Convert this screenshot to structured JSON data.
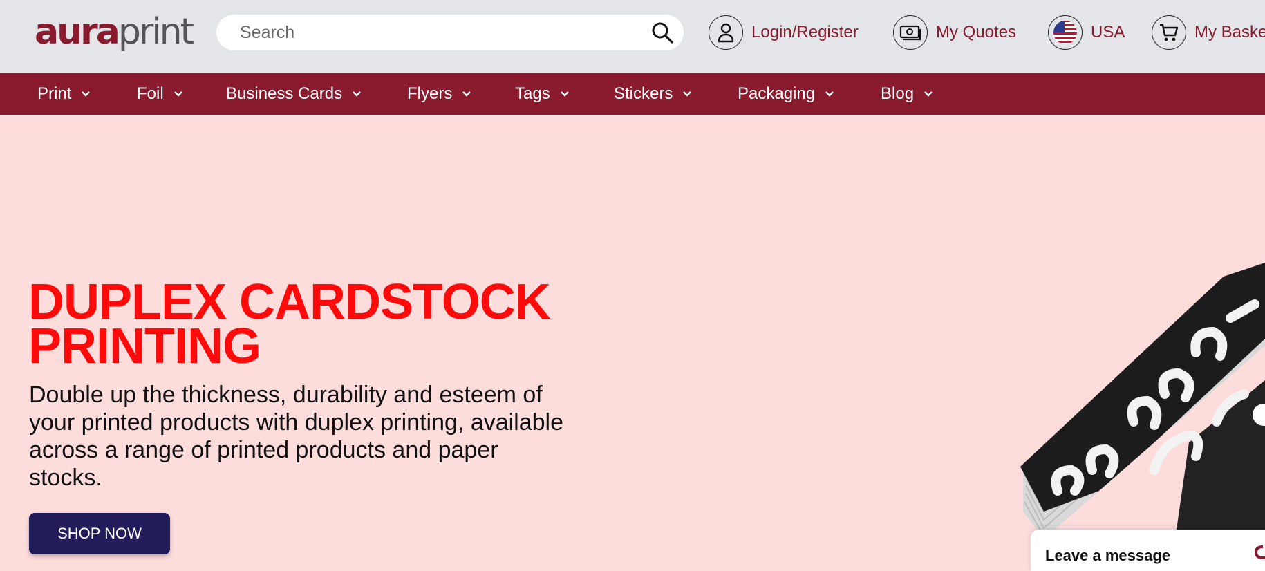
{
  "brand": {
    "logo_part1": "aura",
    "logo_part2": "print",
    "primary_color": "#8a1a2e",
    "hero_bg": "#fddcdc",
    "title_color": "#ff0a0a",
    "button_color": "#221d5a"
  },
  "search": {
    "placeholder": "Search",
    "icon": "search-icon"
  },
  "header_links": [
    {
      "label": "Login/Register",
      "icon": "user-icon"
    },
    {
      "label": "My Quotes",
      "icon": "money-icon"
    },
    {
      "label": "USA",
      "icon": "us-flag-icon"
    },
    {
      "label": "My Basket",
      "icon": "cart-icon"
    }
  ],
  "nav": [
    {
      "label": "Print"
    },
    {
      "label": "Foil"
    },
    {
      "label": "Business Cards"
    },
    {
      "label": "Flyers"
    },
    {
      "label": "Tags"
    },
    {
      "label": "Stickers"
    },
    {
      "label": "Packaging"
    },
    {
      "label": "Blog"
    }
  ],
  "hero": {
    "title_line1": "DUPLEX CARDSTOCK",
    "title_line2": "PRINTING",
    "description": "Double up the thickness, durability and esteem of your printed products with duplex printing, available across a range of printed products and paper stocks.",
    "button_label": "SHOP NOW"
  },
  "chat": {
    "label": "Leave a message",
    "icon": "chat-icon"
  }
}
